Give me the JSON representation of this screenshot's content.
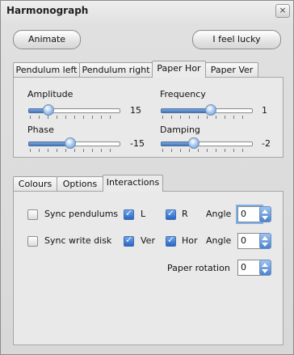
{
  "window": {
    "title": "Harmonograph",
    "close_glyph": "×"
  },
  "buttons": {
    "animate": "Animate",
    "lucky": "I feel lucky"
  },
  "tabs_top": [
    {
      "label": "Pendulum left",
      "active": false
    },
    {
      "label": "Pendulum right",
      "active": false
    },
    {
      "label": "Paper Hor",
      "active": true
    },
    {
      "label": "Paper Ver",
      "active": false
    }
  ],
  "sliders": {
    "amplitude": {
      "label": "Amplitude",
      "value": "15",
      "fraction": 0.22
    },
    "frequency": {
      "label": "Frequency",
      "value": "1",
      "fraction": 0.54
    },
    "phase": {
      "label": "Phase",
      "value": "-15",
      "fraction": 0.46
    },
    "damping": {
      "label": "Damping",
      "value": "-2",
      "fraction": 0.36
    }
  },
  "tabs_bottom": [
    {
      "label": "Colours",
      "active": false
    },
    {
      "label": "Options",
      "active": false
    },
    {
      "label": "Interactions",
      "active": true
    }
  ],
  "interactions": {
    "row1": {
      "sync_label": "Sync pendulums",
      "sync_checked": false,
      "l_label": "L",
      "l_checked": true,
      "r_label": "R",
      "r_checked": true,
      "angle_label": "Angle",
      "angle_value": "0"
    },
    "row2": {
      "sync_label": "Sync write disk",
      "sync_checked": false,
      "ver_label": "Ver",
      "ver_checked": true,
      "hor_label": "Hor",
      "hor_checked": true,
      "angle_label": "Angle",
      "angle_value": "0"
    },
    "paper_rotation": {
      "label": "Paper rotation",
      "value": "0"
    }
  },
  "icons": {
    "close": "close-icon",
    "check": "check-icon",
    "spinner": "spinner-arrows-icon"
  },
  "colors": {
    "accent": "#3f75bf",
    "checkbox_checked": "#2b66c2"
  }
}
